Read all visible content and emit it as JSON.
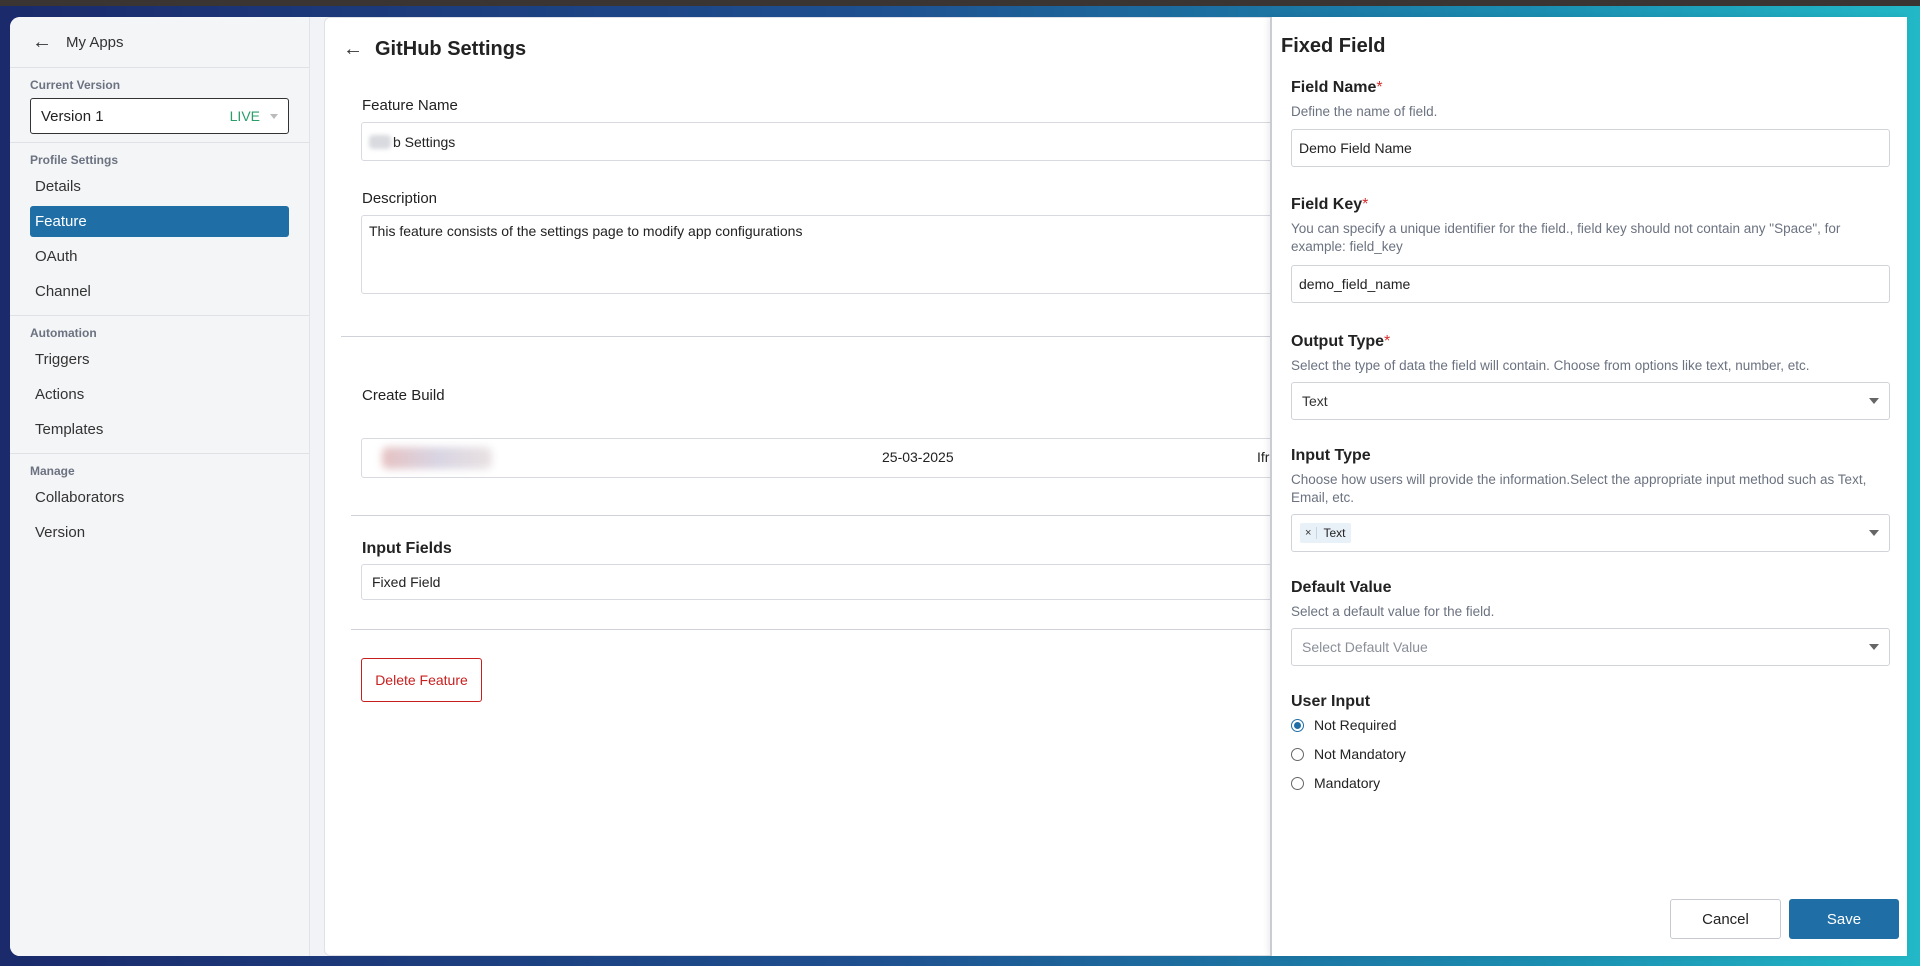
{
  "sidebar": {
    "back_label": "My Apps",
    "current_version_title": "Current Version",
    "version_value": "Version 1",
    "version_status": "LIVE",
    "profile_settings_title": "Profile Settings",
    "profile_items": [
      {
        "label": "Details"
      },
      {
        "label": "Feature"
      },
      {
        "label": "OAuth"
      },
      {
        "label": "Channel"
      }
    ],
    "automation_title": "Automation",
    "automation_items": [
      {
        "label": "Triggers"
      },
      {
        "label": "Actions"
      },
      {
        "label": "Templates"
      }
    ],
    "manage_title": "Manage",
    "manage_items": [
      {
        "label": "Collaborators"
      },
      {
        "label": "Version"
      }
    ]
  },
  "main": {
    "title": "GitHub Settings",
    "feature_name_label": "Feature Name",
    "feature_name_value": "b Settings",
    "description_label": "Description",
    "description_value": "This feature consists of the settings page to modify app configurations",
    "create_build_label": "Create Build",
    "build_date": "25-03-2025",
    "build_tail": "Ifr",
    "input_fields_label": "Input Fields",
    "input_field_item": "Fixed Field",
    "delete_label": "Delete Feature"
  },
  "drawer": {
    "title": "Fixed Field",
    "field_name": {
      "label": "Field Name",
      "required_mark": "*",
      "help": "Define the name of field.",
      "value": "Demo Field Name"
    },
    "field_key": {
      "label": "Field Key",
      "required_mark": "*",
      "help": "You can specify a unique identifier for the field., field key should not contain any \"Space\", for example: field_key",
      "value": "demo_field_name"
    },
    "output_type": {
      "label": "Output Type",
      "required_mark": "*",
      "help": "Select the type of data the field will contain. Choose from options like text, number, etc.",
      "value": "Text"
    },
    "input_type": {
      "label": "Input Type",
      "help": "Choose how users will provide the information.Select the appropriate input method such as Text, Email, etc.",
      "tag_remove": "×",
      "tag_value": "Text"
    },
    "default_value": {
      "label": "Default Value",
      "help": "Select a default value for the field.",
      "placeholder": "Select Default Value"
    },
    "user_input": {
      "label": "User Input",
      "options": [
        {
          "label": "Not Required",
          "selected": true
        },
        {
          "label": "Not Mandatory",
          "selected": false
        },
        {
          "label": "Mandatory",
          "selected": false
        }
      ]
    },
    "cancel_label": "Cancel",
    "save_label": "Save"
  },
  "colors": {
    "accent": "#1f6fa6",
    "live": "#2a9d6b",
    "danger": "#c81e1e",
    "required": "#d32f2f"
  }
}
